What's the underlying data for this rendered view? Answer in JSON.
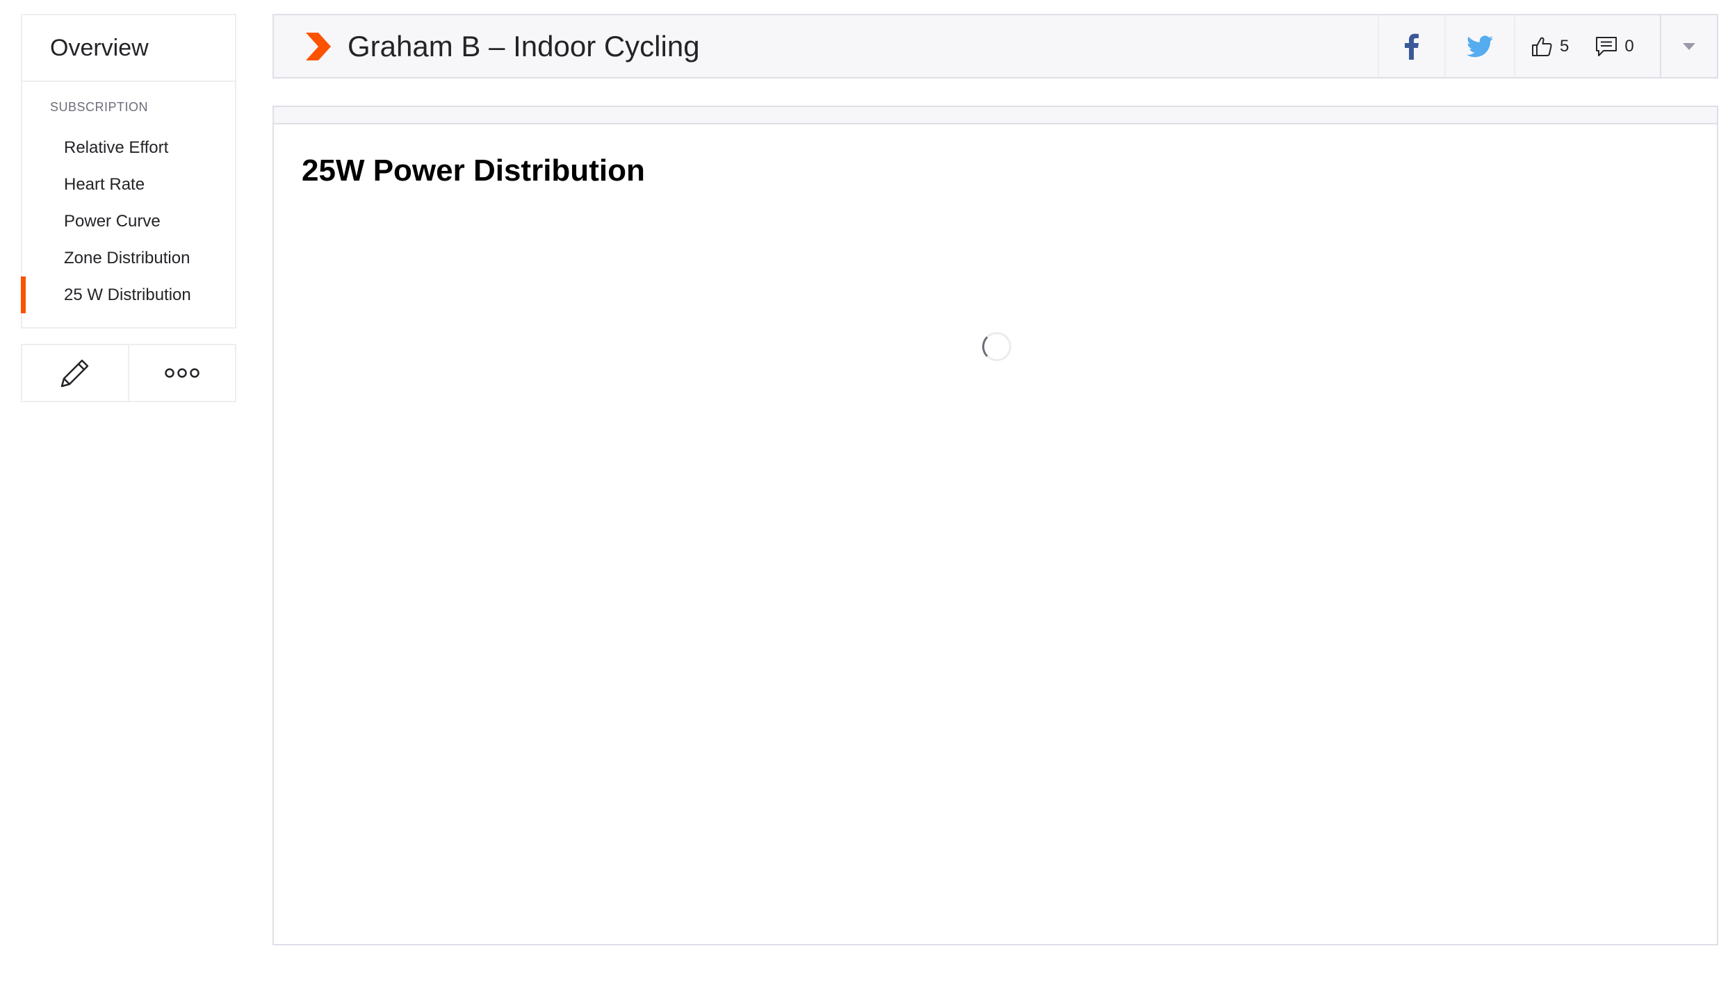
{
  "sidebar": {
    "overview_label": "Overview",
    "section_header": "SUBSCRIPTION",
    "items": [
      {
        "label": "Relative Effort"
      },
      {
        "label": "Heart Rate"
      },
      {
        "label": "Power Curve"
      },
      {
        "label": "Zone Distribution"
      },
      {
        "label": "25 W Distribution",
        "active": true
      }
    ],
    "actions": [
      {
        "icon": "pencil-icon"
      },
      {
        "icon": "more-options-icon"
      }
    ]
  },
  "header": {
    "brand_icon": "strava-chevron-icon",
    "title": "Graham B – Indoor Cycling",
    "share": [
      {
        "icon": "facebook-icon",
        "color": "#3b5998"
      },
      {
        "icon": "twitter-icon",
        "color": "#55acee"
      }
    ],
    "kudos_count": "5",
    "comment_count": "0",
    "menu_icon": "chevron-down-icon"
  },
  "main": {
    "title": "25W Power Distribution",
    "loading": true
  },
  "colors": {
    "accent": "#fc5200",
    "border": "#dfdfe8",
    "header_bg": "#f7f7fa",
    "text": "#242428"
  }
}
